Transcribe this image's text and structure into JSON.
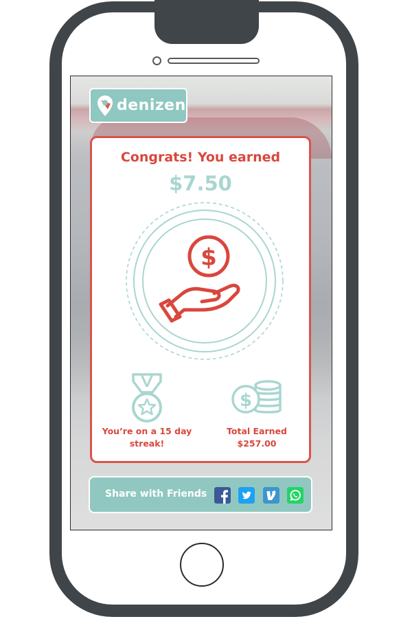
{
  "app": {
    "brand": "denizen"
  },
  "card": {
    "title": "Congrats! You earned",
    "amount": "$7.50",
    "hero_icon": "hand-coin-icon"
  },
  "stats": {
    "streak": {
      "icon": "medal-icon",
      "label_line1": "You’re on a 15 day",
      "label_line2": "streak!"
    },
    "total": {
      "icon": "coins-stack-icon",
      "label_line1": "Total Earned",
      "label_line2": "$257.00"
    }
  },
  "share": {
    "label": "Share with Friends",
    "icons": [
      "facebook-icon",
      "twitter-icon",
      "venmo-icon",
      "whatsapp-icon"
    ]
  },
  "colors": {
    "accent_red": "#d9473d",
    "teal": "#90c8c1",
    "teal_light": "#a9d6d0",
    "phone_frame": "#3f4549",
    "facebook": "#3b5998",
    "twitter": "#1da1f2",
    "venmo": "#3d95ce",
    "whatsapp": "#25d366"
  }
}
